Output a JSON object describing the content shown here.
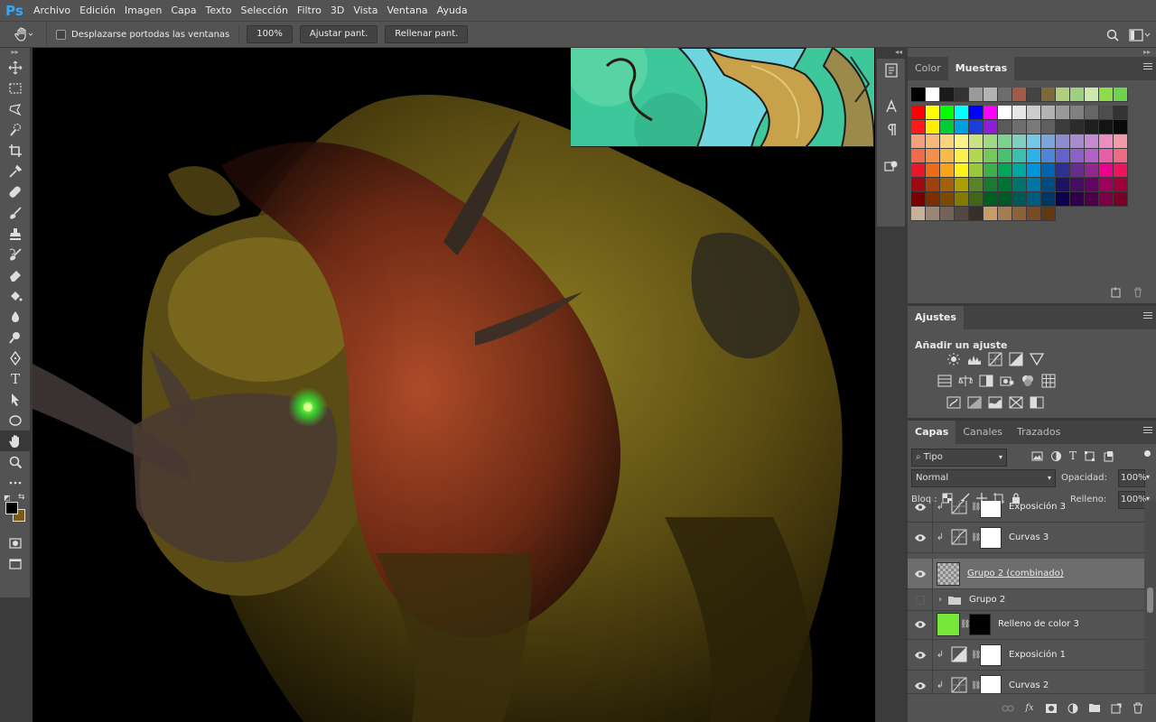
{
  "app": {
    "logo": "Ps"
  },
  "menu": [
    "Archivo",
    "Edición",
    "Imagen",
    "Capa",
    "Texto",
    "Selección",
    "Filtro",
    "3D",
    "Vista",
    "Ventana",
    "Ayuda"
  ],
  "options": {
    "tool_icon": "hand-icon",
    "scroll_all_label": "Desplazarse portodas las ventanas",
    "zoom_value": "100%",
    "fit_screen": "Ajustar pant.",
    "fill_screen": "Rellenar pant."
  },
  "toolbar": {
    "tools": [
      "move-icon",
      "marquee-icon",
      "lasso-icon",
      "quick-select-icon",
      "crop-icon",
      "eyedropper-icon",
      "healing-icon",
      "brush-icon",
      "stamp-icon",
      "history-brush-icon",
      "eraser-icon",
      "paint-bucket-icon",
      "blur-icon",
      "dodge-icon",
      "pen-icon",
      "type-icon",
      "path-select-icon",
      "ellipse-icon",
      "hand-icon",
      "zoom-icon",
      "more-icon"
    ],
    "active_tool": "hand-icon",
    "foreground_color": "#000000",
    "background_color": "#7a5b17",
    "type_glyph": "T"
  },
  "swatches_panel": {
    "tabs": [
      "Color",
      "Muestras"
    ],
    "active_tab": "Muestras",
    "rows": [
      [
        "#000000",
        "#ffffff",
        "#1a1a1a",
        "#333333",
        "#9a9a9a",
        "#b3b3b3",
        "#6d6d6d",
        "#a55a45",
        "#444444",
        "#7d6a3a",
        "#b1cf7a",
        "#9ed07d",
        "#cde7ad",
        "#8edb4b",
        "#6ed44c"
      ],
      [
        "#ff0000",
        "#ffff00",
        "#00ff00",
        "#00ffff",
        "#0000ff",
        "#ff00ff",
        "#ffffff",
        "#e6e6e6",
        "#cccccc",
        "#b3b3b3",
        "#999999",
        "#808080",
        "#666666",
        "#4d4d4d",
        "#333333"
      ],
      [
        "#ff1a1a",
        "#ffee00",
        "#00cc33",
        "#00a0e0",
        "#1a3fd6",
        "#8a1fd6",
        "#5a5a5a",
        "#6e6e6e",
        "#7a7a7a",
        "#5f5f5f",
        "#3c3c3c",
        "#2c2c2c",
        "#1f1f1f",
        "#141414",
        "#0a0a0a"
      ],
      [
        "#f4a07a",
        "#f6b97a",
        "#fbd37f",
        "#fff28a",
        "#c9e285",
        "#9fd983",
        "#7dd28d",
        "#7ecfc1",
        "#75c7e8",
        "#7aa6dc",
        "#8a8dd0",
        "#a68bd0",
        "#c48bd2",
        "#ec8fc0",
        "#f19aa8"
      ],
      [
        "#ef6b4a",
        "#f28f4a",
        "#f9b84a",
        "#fff04f",
        "#b1d653",
        "#75c85c",
        "#4cbf71",
        "#3cbfae",
        "#2fb2e6",
        "#4c86d4",
        "#6464c8",
        "#8a62c7",
        "#b062c8",
        "#e65fa8",
        "#ee6b86"
      ],
      [
        "#e8182a",
        "#ed6a1b",
        "#f7a31b",
        "#fff21a",
        "#98c93c",
        "#3fad49",
        "#00a65a",
        "#00a99d",
        "#0095da",
        "#0064b0",
        "#2e3192",
        "#662d91",
        "#92278f",
        "#ec008c",
        "#ed145b"
      ],
      [
        "#9e0b0f",
        "#a0410d",
        "#a36209",
        "#aba000",
        "#598527",
        "#197b30",
        "#007236",
        "#00746b",
        "#0076a3",
        "#004b80",
        "#1b1464",
        "#440e62",
        "#630460",
        "#9e005d",
        "#9e0039"
      ],
      [
        "#790000",
        "#7b2e00",
        "#7d4900",
        "#827b00",
        "#406618",
        "#005e20",
        "#005826",
        "#005952",
        "#005b7f",
        "#003663",
        "#0d004c",
        "#32004b",
        "#4b0049",
        "#7b0046",
        "#7a0026"
      ],
      [
        "#c7b299",
        "#998675",
        "#736357",
        "#534741",
        "#37302a",
        "#c69c6d",
        "#a67c52",
        "#8c6239",
        "#754c24",
        "#603813"
      ]
    ]
  },
  "adjustments_panel": {
    "tab": "Ajustes",
    "add_label": "Añadir un ajuste"
  },
  "layers_panel": {
    "tabs": [
      "Capas",
      "Canales",
      "Trazados"
    ],
    "active_tab": "Capas",
    "filter_kind": "Tipo",
    "blend_mode": "Normal",
    "opacity_label": "Opacidad:",
    "opacity_value": "100%",
    "lock_label": "Bloq.:",
    "fill_label": "Relleno:",
    "fill_value": "100%",
    "layers": [
      {
        "name": "Exposición 3",
        "visible": true,
        "clipped": true,
        "thumb": "curves",
        "mask": "#ffffff",
        "selected": false,
        "group": false
      },
      {
        "name": "Curvas 3",
        "visible": true,
        "clipped": true,
        "thumb": "curves",
        "mask": "#ffffff",
        "selected": false,
        "group": false
      },
      {
        "name": "Grupo 2 (combinado)",
        "visible": true,
        "clipped": false,
        "thumb": "checker",
        "mask": "",
        "selected": true,
        "group": false
      },
      {
        "name": "Grupo 2",
        "visible": false,
        "clipped": false,
        "thumb": "folder",
        "mask": "",
        "selected": false,
        "group": true
      },
      {
        "name": "Relleno de color 3",
        "visible": true,
        "clipped": false,
        "thumb": "#77e83a",
        "mask": "#000000",
        "selected": false,
        "group": false
      },
      {
        "name": "Exposición 1",
        "visible": true,
        "clipped": true,
        "thumb": "exposure",
        "mask": "#ffffff",
        "selected": false,
        "group": false
      },
      {
        "name": "Curvas 2",
        "visible": true,
        "clipped": true,
        "thumb": "curves",
        "mask": "#ffffff",
        "selected": false,
        "group": false
      }
    ],
    "footer_icons": [
      "link-icon",
      "fx-icon",
      "mask-icon",
      "adjustment-icon",
      "folder-icon",
      "new-layer-icon",
      "trash-icon"
    ],
    "fx_label": "fx"
  }
}
